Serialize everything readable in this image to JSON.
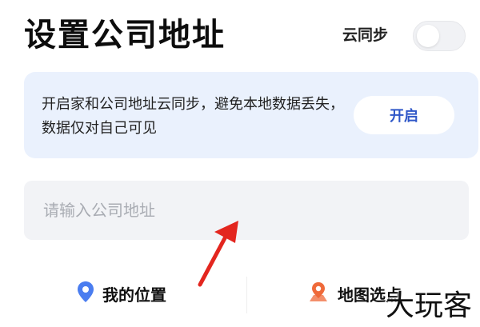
{
  "header": {
    "title": "设置公司地址",
    "sync_label": "云同步",
    "sync_enabled": false
  },
  "banner": {
    "text": "开启家和公司地址云同步，避免本地数据丢失，数据仅对自己可见",
    "button_label": "开启"
  },
  "address_input": {
    "placeholder": "请输入公司地址",
    "value": ""
  },
  "actions": {
    "my_location_label": "我的位置",
    "map_pick_label": "地图选点"
  },
  "watermark": "大玩客",
  "colors": {
    "accent_blue": "#2f57c8",
    "banner_bg": "#eaf1fd",
    "location_pin_blue": "#4a7df0",
    "map_pin_orange": "#ef6a3a",
    "arrow_red": "#e3261f"
  }
}
